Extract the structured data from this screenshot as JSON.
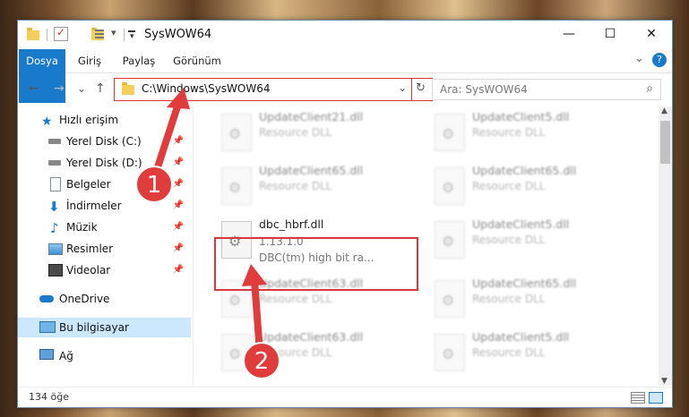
{
  "window": {
    "title": "SysWOW64"
  },
  "window_controls": {
    "minimize": "—",
    "maximize": "☐",
    "close": "✕"
  },
  "ribbon": {
    "tabs": [
      "Dosya",
      "Giriş",
      "Paylaş",
      "Görünüm"
    ],
    "collapse": "⌄",
    "help": "?"
  },
  "nav": {
    "back": "←",
    "forward": "→",
    "recent": "⌄",
    "up": "↑"
  },
  "address": {
    "path": "C:\\Windows\\SysWOW64",
    "dropdown": "⌄",
    "refresh": "↻"
  },
  "search": {
    "placeholder": "Ara: SysWOW64",
    "icon": "⌕"
  },
  "sidebar": {
    "items": [
      {
        "label": "Hızlı erişim",
        "icon": "star-icon",
        "pinned": false
      },
      {
        "label": "Yerel Disk (C:)",
        "icon": "drive-icon",
        "pinned": true
      },
      {
        "label": "Yerel Disk (D:)",
        "icon": "drive-icon",
        "pinned": true
      },
      {
        "label": "Belgeler",
        "icon": "document-icon",
        "pinned": true
      },
      {
        "label": "İndirmeler",
        "icon": "download-icon",
        "pinned": true
      },
      {
        "label": "Müzik",
        "icon": "music-icon",
        "pinned": true
      },
      {
        "label": "Resimler",
        "icon": "image-icon",
        "pinned": true
      },
      {
        "label": "Videolar",
        "icon": "video-icon",
        "pinned": true
      },
      {
        "label": "OneDrive",
        "icon": "cloud-icon",
        "pinned": false
      },
      {
        "label": "Bu bilgisayar",
        "icon": "computer-icon",
        "pinned": false,
        "selected": true
      },
      {
        "label": "Ağ",
        "icon": "network-icon",
        "pinned": false
      }
    ],
    "pin_glyph": "📌"
  },
  "files": {
    "left": [
      {
        "name": "UpdateClient21.dll",
        "type": "Resource DLL"
      },
      {
        "name": "UpdateClient65.dll",
        "type": "Resource DLL"
      },
      {
        "name": "dbc_hbrf.dll",
        "version": "1.13.1.0",
        "description": "DBC(tm) high bit ra...",
        "highlighted": true
      },
      {
        "name": "UpdateClient63.dll",
        "type": "Resource DLL"
      },
      {
        "name": "UpdateClient63.dll",
        "type": "Resource DLL"
      }
    ],
    "right": [
      {
        "name": "UpdateClient5.dll",
        "type": "Resource DLL"
      },
      {
        "name": "UpdateClient65.dll",
        "type": "Resource DLL"
      },
      {
        "name": "UpdateClient5.dll",
        "type": "Resource DLL"
      },
      {
        "name": "UpdateClient65.dll",
        "type": "Resource DLL"
      },
      {
        "name": "UpdateClient5.dll",
        "type": "Resource DLL"
      }
    ]
  },
  "status": {
    "count": "134 öğe"
  },
  "annotations": {
    "step1": "1",
    "step2": "2",
    "accent": "#e03c3c"
  }
}
